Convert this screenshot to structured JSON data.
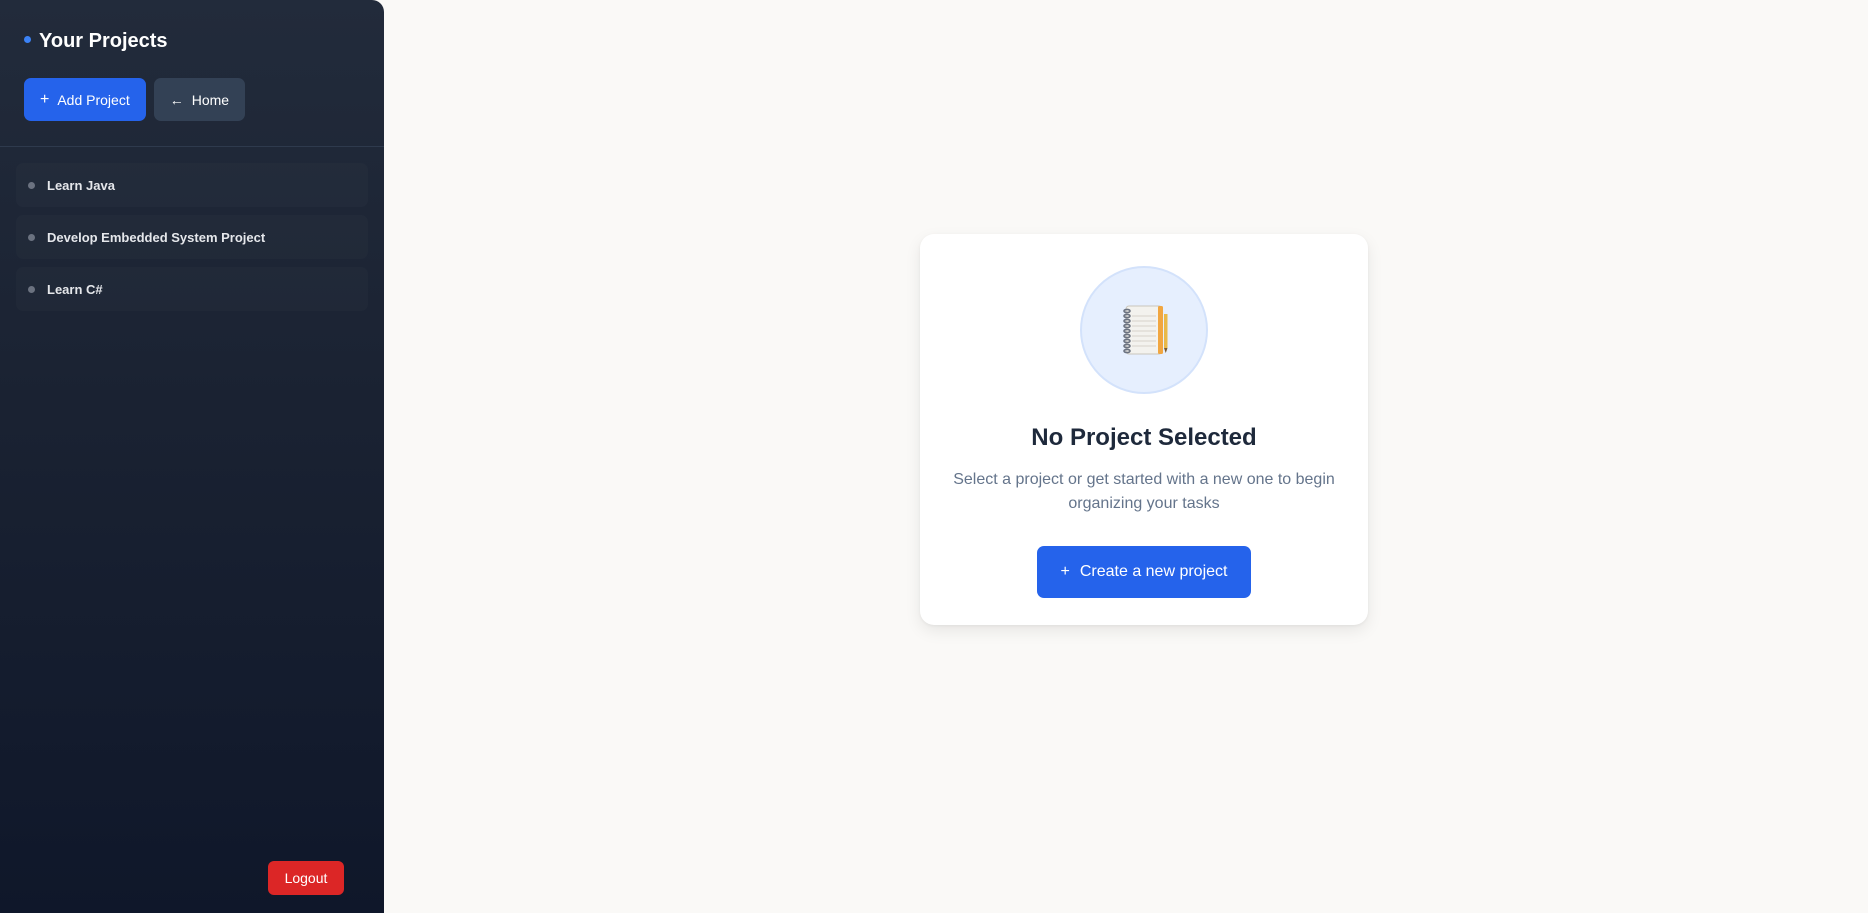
{
  "sidebar": {
    "title": "Your Projects",
    "add_button": {
      "icon": "plus-icon",
      "glyph": "+",
      "label": "Add Project"
    },
    "home_button": {
      "icon": "arrow-left-icon",
      "glyph": "←",
      "label": "Home"
    },
    "projects": [
      {
        "label": "Learn Java"
      },
      {
        "label": "Develop Embedded System Project"
      },
      {
        "label": "Learn C#"
      }
    ],
    "logout_label": "Logout"
  },
  "main": {
    "empty_state": {
      "icon": "notebook-icon",
      "title": "No Project Selected",
      "subtitle": "Select a project or get started with a new one to begin organizing your tasks",
      "create_button": {
        "icon": "plus-icon",
        "glyph": "+",
        "label": "Create a new project"
      }
    }
  },
  "colors": {
    "primary": "#2563eb",
    "danger": "#dc2626",
    "sidebar_bg": "#1a2232",
    "accent_dot": "#3b82f6"
  }
}
